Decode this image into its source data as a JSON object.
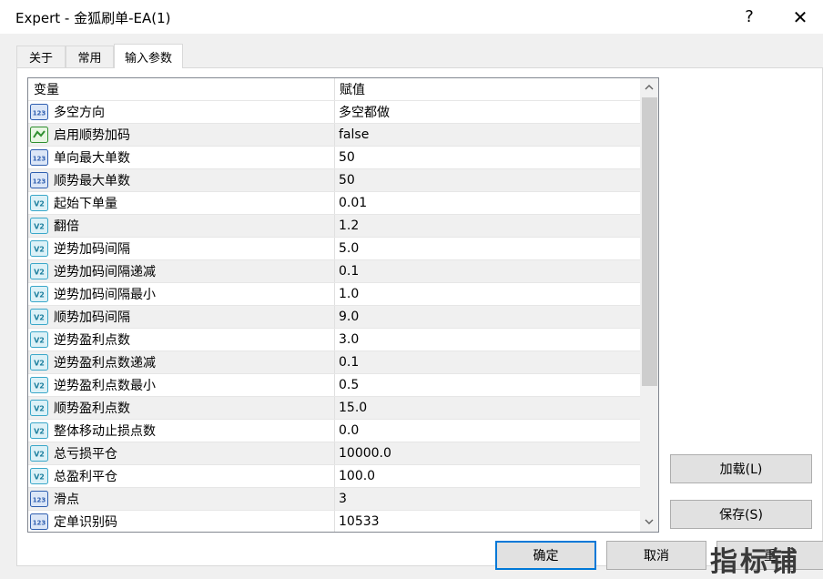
{
  "window": {
    "title": "Expert - 金狐刷单-EA(1)",
    "help_symbol": "?",
    "close_symbol": "✕"
  },
  "tabs": [
    {
      "label": "关于"
    },
    {
      "label": "常用"
    },
    {
      "label": "输入参数"
    }
  ],
  "grid": {
    "col_variable": "变量",
    "col_value": "赋值",
    "rows": [
      {
        "icon": "int-icon",
        "name": "多空方向",
        "value": "多空都做"
      },
      {
        "icon": "bool-icon",
        "name": "启用顺势加码",
        "value": "false"
      },
      {
        "icon": "int-icon",
        "name": "单向最大单数",
        "value": "50"
      },
      {
        "icon": "int-icon",
        "name": "顺势最大单数",
        "value": "50"
      },
      {
        "icon": "double-icon",
        "name": "起始下单量",
        "value": "0.01"
      },
      {
        "icon": "double-icon",
        "name": "翻倍",
        "value": "1.2"
      },
      {
        "icon": "double-icon",
        "name": "逆势加码间隔",
        "value": "5.0"
      },
      {
        "icon": "double-icon",
        "name": "逆势加码间隔递减",
        "value": "0.1"
      },
      {
        "icon": "double-icon",
        "name": "逆势加码间隔最小",
        "value": "1.0"
      },
      {
        "icon": "double-icon",
        "name": "顺势加码间隔",
        "value": "9.0"
      },
      {
        "icon": "double-icon",
        "name": "逆势盈利点数",
        "value": "3.0"
      },
      {
        "icon": "double-icon",
        "name": "逆势盈利点数递减",
        "value": "0.1"
      },
      {
        "icon": "double-icon",
        "name": "逆势盈利点数最小",
        "value": "0.5"
      },
      {
        "icon": "double-icon",
        "name": "顺势盈利点数",
        "value": "15.0"
      },
      {
        "icon": "double-icon",
        "name": "整体移动止损点数",
        "value": "0.0"
      },
      {
        "icon": "double-icon",
        "name": "总亏损平仓",
        "value": "10000.0"
      },
      {
        "icon": "double-icon",
        "name": "总盈利平仓",
        "value": "100.0"
      },
      {
        "icon": "int-icon",
        "name": "滑点",
        "value": "3"
      },
      {
        "icon": "int-icon",
        "name": "定单识别码",
        "value": "10533"
      }
    ]
  },
  "buttons": {
    "load": "加载(L)",
    "save": "保存(S)",
    "ok": "确定",
    "cancel": "取消",
    "reset_partial": "重"
  },
  "watermark": "指标铺",
  "icon_glyphs": {
    "int": "123",
    "double": "V2"
  },
  "colors": {
    "accent": "#0078d7",
    "int_icon": "#2f5fb0",
    "bool_icon": "#2f8f2f",
    "double_icon": "#3aa7c9",
    "alt_row": "#f0f0f0"
  }
}
